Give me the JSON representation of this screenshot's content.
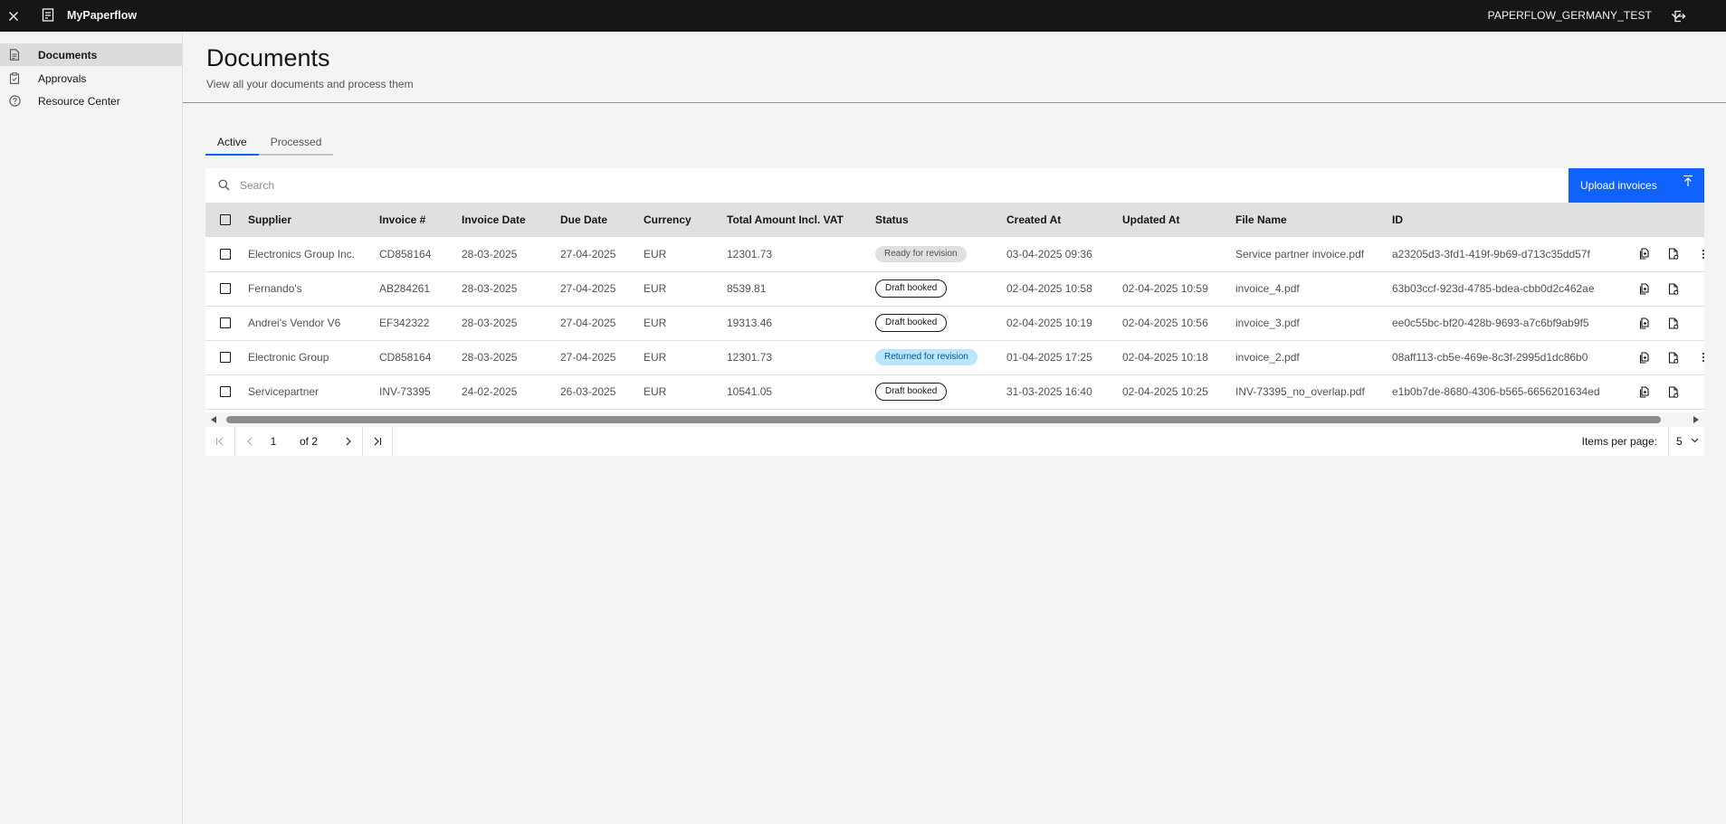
{
  "header": {
    "app_title": "MyPaperflow",
    "tenant": "PAPERFLOW_GERMANY_TEST"
  },
  "sidebar": {
    "items": [
      {
        "label": "Documents",
        "icon": "document-icon",
        "active": true
      },
      {
        "label": "Approvals",
        "icon": "clipboard-icon",
        "active": false
      },
      {
        "label": "Resource Center",
        "icon": "help-icon",
        "active": false
      }
    ]
  },
  "page": {
    "title": "Documents",
    "subtitle": "View all your documents and process them"
  },
  "tabs": [
    {
      "label": "Active",
      "active": true
    },
    {
      "label": "Processed",
      "active": false
    }
  ],
  "toolbar": {
    "search_placeholder": "Search",
    "upload_label": "Upload invoices"
  },
  "table": {
    "columns": [
      "Supplier",
      "Invoice #",
      "Invoice Date",
      "Due Date",
      "Currency",
      "Total Amount Incl. VAT",
      "Status",
      "Created At",
      "Updated At",
      "File Name",
      "ID"
    ],
    "rows": [
      {
        "supplier": "Electronics Group Inc.",
        "invoice": "CD858164",
        "invoice_date": "28-03-2025",
        "due_date": "27-04-2025",
        "currency": "EUR",
        "total": "12301.73",
        "status": "Ready for revision",
        "status_style": "gray",
        "created": "03-04-2025 09:36",
        "updated": "",
        "file": "Service partner invoice.pdf",
        "id": "a23205d3-3fd1-419f-9b69-d713c35dd57f"
      },
      {
        "supplier": "Fernando's",
        "invoice": "AB284261",
        "invoice_date": "28-03-2025",
        "due_date": "27-04-2025",
        "currency": "EUR",
        "total": "8539.81",
        "status": "Draft booked",
        "status_style": "outline",
        "created": "02-04-2025 10:58",
        "updated": "02-04-2025 10:59",
        "file": "invoice_4.pdf",
        "id": "63b03ccf-923d-4785-bdea-cbb0d2c462ae"
      },
      {
        "supplier": "Andrei's Vendor V6",
        "invoice": "EF342322",
        "invoice_date": "28-03-2025",
        "due_date": "27-04-2025",
        "currency": "EUR",
        "total": "19313.46",
        "status": "Draft booked",
        "status_style": "outline",
        "created": "02-04-2025 10:19",
        "updated": "02-04-2025 10:56",
        "file": "invoice_3.pdf",
        "id": "ee0c55bc-bf20-428b-9693-a7c6bf9ab9f5"
      },
      {
        "supplier": "Electronic Group",
        "invoice": "CD858164",
        "invoice_date": "28-03-2025",
        "due_date": "27-04-2025",
        "currency": "EUR",
        "total": "12301.73",
        "status": "Returned for revision",
        "status_style": "blue",
        "created": "01-04-2025 17:25",
        "updated": "02-04-2025 10:18",
        "file": "invoice_2.pdf",
        "id": "08aff113-cb5e-469e-8c3f-2995d1dc86b0"
      },
      {
        "supplier": "Servicepartner",
        "invoice": "INV-73395",
        "invoice_date": "24-02-2025",
        "due_date": "26-03-2025",
        "currency": "EUR",
        "total": "10541.05",
        "status": "Draft booked",
        "status_style": "outline",
        "created": "31-03-2025 16:40",
        "updated": "02-04-2025 10:25",
        "file": "INV-73395_no_overlap.pdf",
        "id": "e1b0b7de-8680-4306-b565-6656201634ed"
      }
    ]
  },
  "pagination": {
    "current_page": "1",
    "of_label": "of 2",
    "items_per_page_label": "Items per page:",
    "items_per_page": "5"
  },
  "colors": {
    "header_bg": "#161616",
    "accent": "#0f62fe",
    "returned_badge_bg": "#bae6ff"
  }
}
